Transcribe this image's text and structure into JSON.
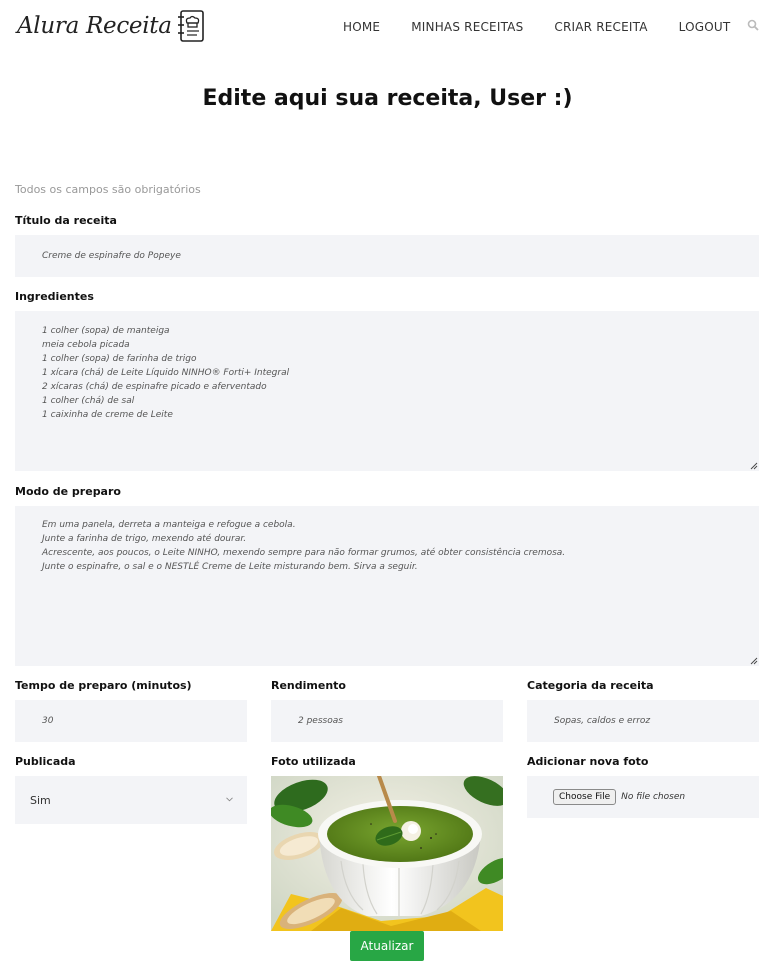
{
  "header": {
    "logo_text": "Alura Receita",
    "nav": [
      "HOME",
      "MINHAS RECEITAS",
      "CRIAR RECEITA",
      "LOGOUT"
    ]
  },
  "page_title": "Edite aqui sua receita, User :)",
  "form": {
    "required_note": "Todos os campos são obrigatórios",
    "title_label": "Título da receita",
    "title_value": "Creme de espinafre do Popeye",
    "ingredients_label": "Ingredientes",
    "ingredients_lines": [
      "1 colher (sopa) de manteiga",
      "meia cebola picada",
      "1 colher (sopa) de farinha de trigo",
      "1 xícara (chá) de Leite Líquido NINHO® Forti+ Integral",
      "2 xícaras (chá) de espinafre picado e aferventado",
      "1 colher (chá) de sal",
      "1 caixinha de creme de Leite"
    ],
    "method_label": "Modo de preparo",
    "method_lines": [
      "Em uma panela, derreta a manteiga e refogue a cebola.",
      "Junte a farinha de trigo, mexendo até dourar.",
      "Acrescente, aos poucos, o Leite NINHO, mexendo sempre para não formar grumos, até obter consistência cremosa.",
      "Junte o espinafre, o sal e o NESTLÉ Creme de Leite misturando bem. Sirva a seguir."
    ],
    "prep_time_label": "Tempo de preparo (minutos)",
    "prep_time_value": "30",
    "yield_label": "Rendimento",
    "yield_value": "2 pessoas",
    "category_label": "Categoria da receita",
    "category_value": "Sopas, caldos e erroz",
    "published_label": "Publicada",
    "published_value": "Sim",
    "photo_label": "Foto utilizada",
    "new_photo_label": "Adicionar nova foto",
    "file_button": "Choose File",
    "file_status": "No file chosen",
    "submit_label": "Atualizar"
  },
  "colors": {
    "field_bg": "#f3f4f7",
    "submit_bg": "#28a745",
    "soup_green": "#5f8a1f"
  }
}
